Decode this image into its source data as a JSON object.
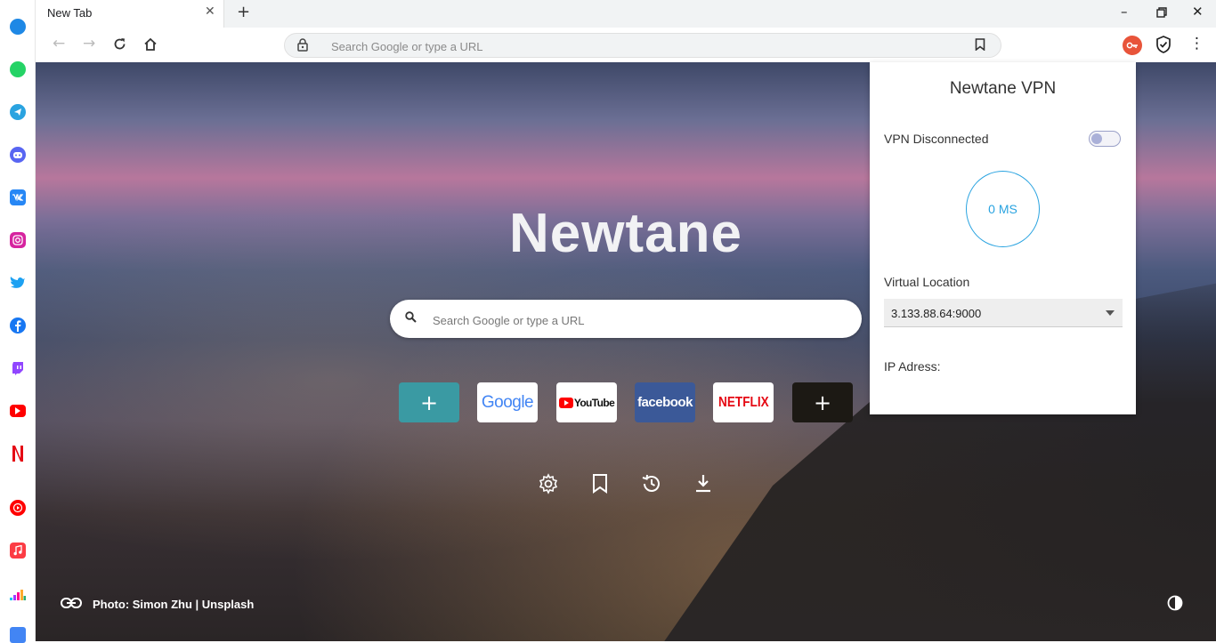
{
  "tab": {
    "title": "New Tab"
  },
  "omnibox": {
    "placeholder": "Search Google or type a URL"
  },
  "ntp": {
    "logo": "Newtane",
    "search_placeholder": "Search Google or type a URL",
    "tiles": [
      {
        "label": "+",
        "kind": "add",
        "color": "#3a9aa3"
      },
      {
        "label": "Google",
        "kind": "site",
        "color": "#ffffff"
      },
      {
        "label": "YouTube",
        "kind": "site",
        "color": "#ffffff"
      },
      {
        "label": "facebook",
        "kind": "site",
        "color": "#3b5998"
      },
      {
        "label": "NETFLIX",
        "kind": "site",
        "color": "#ffffff"
      },
      {
        "label": "+",
        "kind": "add",
        "color": "#1c1914"
      }
    ],
    "credit": "Photo: Simon Zhu | Unsplash"
  },
  "vpn": {
    "title": "Newtane VPN",
    "status": "VPN Disconnected",
    "connected": false,
    "ping": "0 MS",
    "location_label": "Virtual Location",
    "location_value": "3.133.88.64:9000",
    "ip_label": "IP Adress:"
  },
  "sidebar": {
    "apps": [
      {
        "name": "messenger",
        "color": "#1e88e5",
        "glyph": ""
      },
      {
        "name": "whatsapp",
        "color": "#25d366",
        "glyph": ""
      },
      {
        "name": "telegram",
        "color": "#2aa3e0",
        "glyph": ""
      },
      {
        "name": "discord",
        "color": "#5865f2",
        "glyph": ""
      },
      {
        "name": "vk",
        "color": "#2787f5",
        "glyph": ""
      },
      {
        "name": "instagram",
        "color": "#d6249f",
        "glyph": ""
      },
      {
        "name": "twitter",
        "color": "#1da1f2",
        "glyph": ""
      },
      {
        "name": "facebook",
        "color": "#1877f2",
        "glyph": ""
      },
      {
        "name": "twitch",
        "color": "#9146ff",
        "glyph": ""
      },
      {
        "name": "youtube",
        "color": "#ff0000",
        "glyph": ""
      },
      {
        "name": "netflix",
        "color": "#e50914",
        "glyph": ""
      },
      {
        "name": "youtube-music",
        "color": "#ff0000",
        "glyph": ""
      },
      {
        "name": "apple-music",
        "color": "#fc3c44",
        "glyph": ""
      },
      {
        "name": "deezer",
        "color": "#00c7f2",
        "glyph": ""
      },
      {
        "name": "google-translate",
        "color": "#4285f4",
        "glyph": ""
      }
    ]
  }
}
